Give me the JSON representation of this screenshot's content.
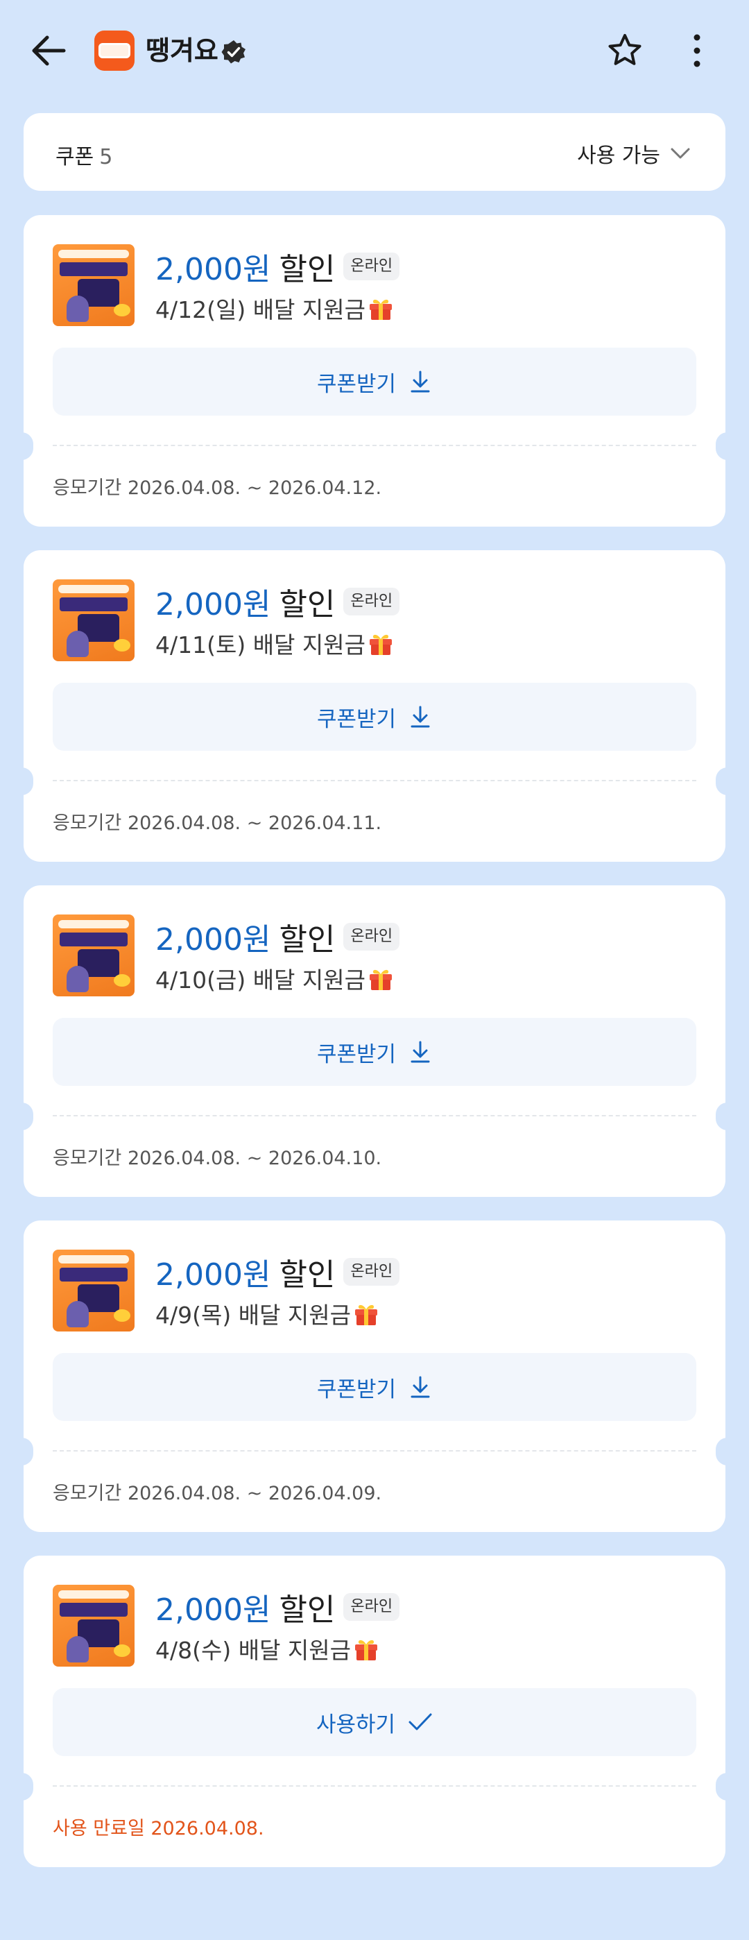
{
  "header": {
    "store_name": "땡겨요"
  },
  "filter": {
    "label": "쿠폰",
    "count": "5",
    "select_value": "사용 가능"
  },
  "coupons": [
    {
      "amount": "2,000원",
      "discount": "할인",
      "badge": "온라인",
      "desc": "4/12(일) 배달 지원금",
      "action": "쿠폰받기",
      "action_icon": "download-icon",
      "period": "응모기간 2026.04.08. ~ 2026.04.12."
    },
    {
      "amount": "2,000원",
      "discount": "할인",
      "badge": "온라인",
      "desc": "4/11(토) 배달 지원금",
      "action": "쿠폰받기",
      "action_icon": "download-icon",
      "period": "응모기간 2026.04.08. ~ 2026.04.11."
    },
    {
      "amount": "2,000원",
      "discount": "할인",
      "badge": "온라인",
      "desc": "4/10(금) 배달 지원금",
      "action": "쿠폰받기",
      "action_icon": "download-icon",
      "period": "응모기간 2026.04.08. ~ 2026.04.10."
    },
    {
      "amount": "2,000원",
      "discount": "할인",
      "badge": "온라인",
      "desc": "4/9(목) 배달 지원금",
      "action": "쿠폰받기",
      "action_icon": "download-icon",
      "period": "응모기간 2026.04.08. ~ 2026.04.09."
    },
    {
      "amount": "2,000원",
      "discount": "할인",
      "badge": "온라인",
      "desc": "4/8(수) 배달 지원금",
      "action": "사용하기",
      "action_icon": "check-icon",
      "period": "사용 만료일 2026.04.08."
    }
  ],
  "colors": {
    "background": "#d4e5fb",
    "accent": "#1565c0",
    "expired": "#e2541a",
    "brand": "#f45a1c"
  }
}
